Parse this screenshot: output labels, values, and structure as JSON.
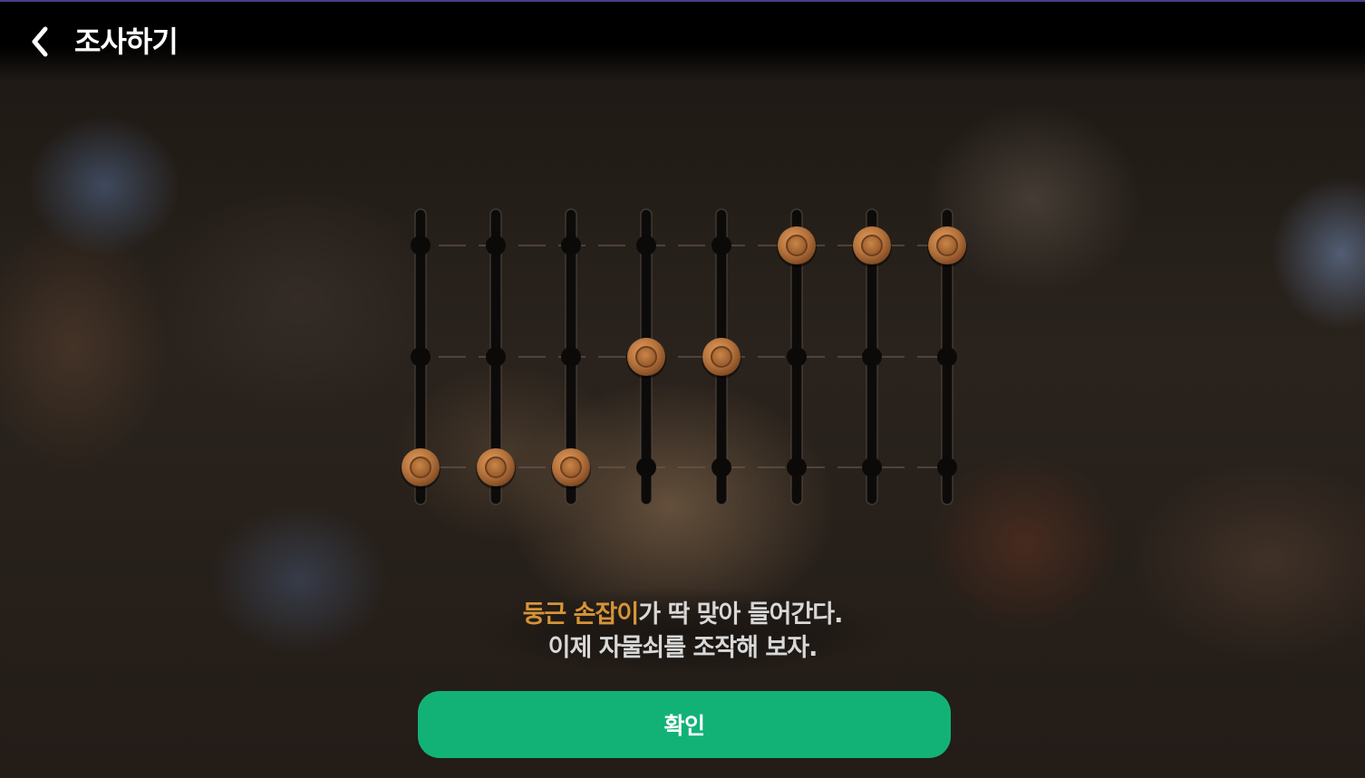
{
  "header": {
    "title": "조사하기",
    "back_icon": "chevron-left-icon"
  },
  "lock_puzzle": {
    "description": "8 vertical slider tracks with 3 positions each; one round knob per track",
    "positions_per_track": 3,
    "track_count": 8,
    "knob_positions": [
      3,
      3,
      3,
      2,
      2,
      1,
      1,
      1
    ],
    "knob_color": "#b5733d"
  },
  "dialog": {
    "line1_highlight": "둥근 손잡이",
    "line1_rest": "가 딱 맞아 들어간다.",
    "line2": "이제 자물쇠를 조작해 보자.",
    "highlight_color": "#d69437"
  },
  "confirm_button": {
    "label": "확인",
    "color": "#12b277"
  }
}
